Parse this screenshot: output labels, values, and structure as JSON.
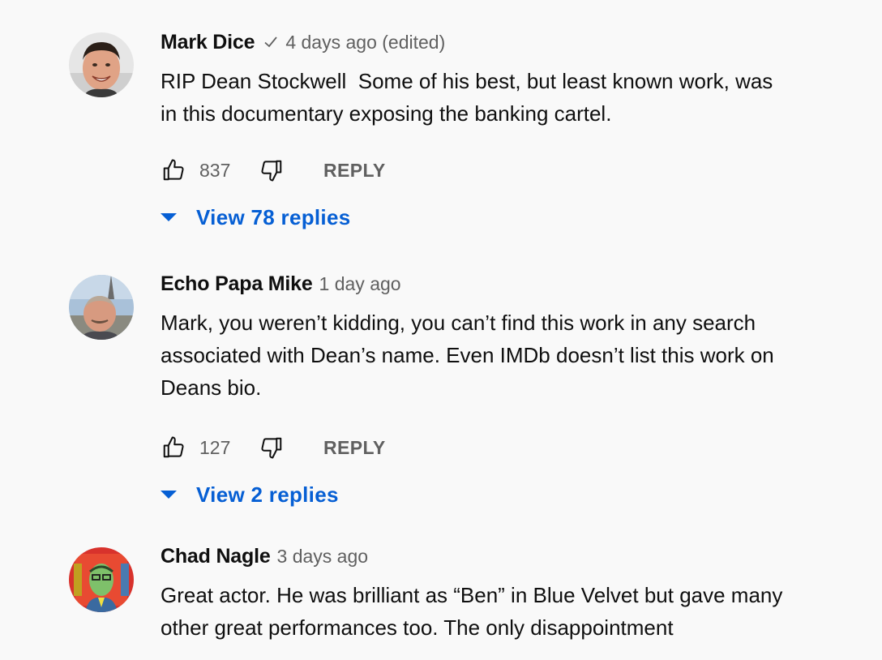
{
  "colors": {
    "background": "#f9f9f9",
    "text_primary": "#0f0f0f",
    "text_secondary": "#606060",
    "link_blue": "#065fd4"
  },
  "comments": [
    {
      "author": "Mark Dice",
      "verified": true,
      "time": "4 days ago (edited)",
      "text": "RIP Dean Stockwell  Some of his best, but least known work, was in this documentary exposing the banking cartel.",
      "likes": "837",
      "reply_label": "REPLY",
      "replies_label": "View 78 replies",
      "avatar_icon": "man-smiling-avatar"
    },
    {
      "author": "Echo Papa Mike",
      "verified": false,
      "time": "1 day ago",
      "text": "Mark, you weren’t kidding, you can’t find this work in any search associated with Dean’s name. Even IMDb doesn’t list this work on Deans bio.",
      "likes": "127",
      "reply_label": "REPLY",
      "replies_label": "View 2 replies",
      "avatar_icon": "man-outdoors-avatar"
    },
    {
      "author": "Chad Nagle",
      "verified": false,
      "time": "3 days ago",
      "text": "Great actor. He was brilliant as “Ben” in Blue Velvet but gave many other great performances too. The only disappointment",
      "avatar_icon": "pop-art-portrait-avatar"
    }
  ]
}
